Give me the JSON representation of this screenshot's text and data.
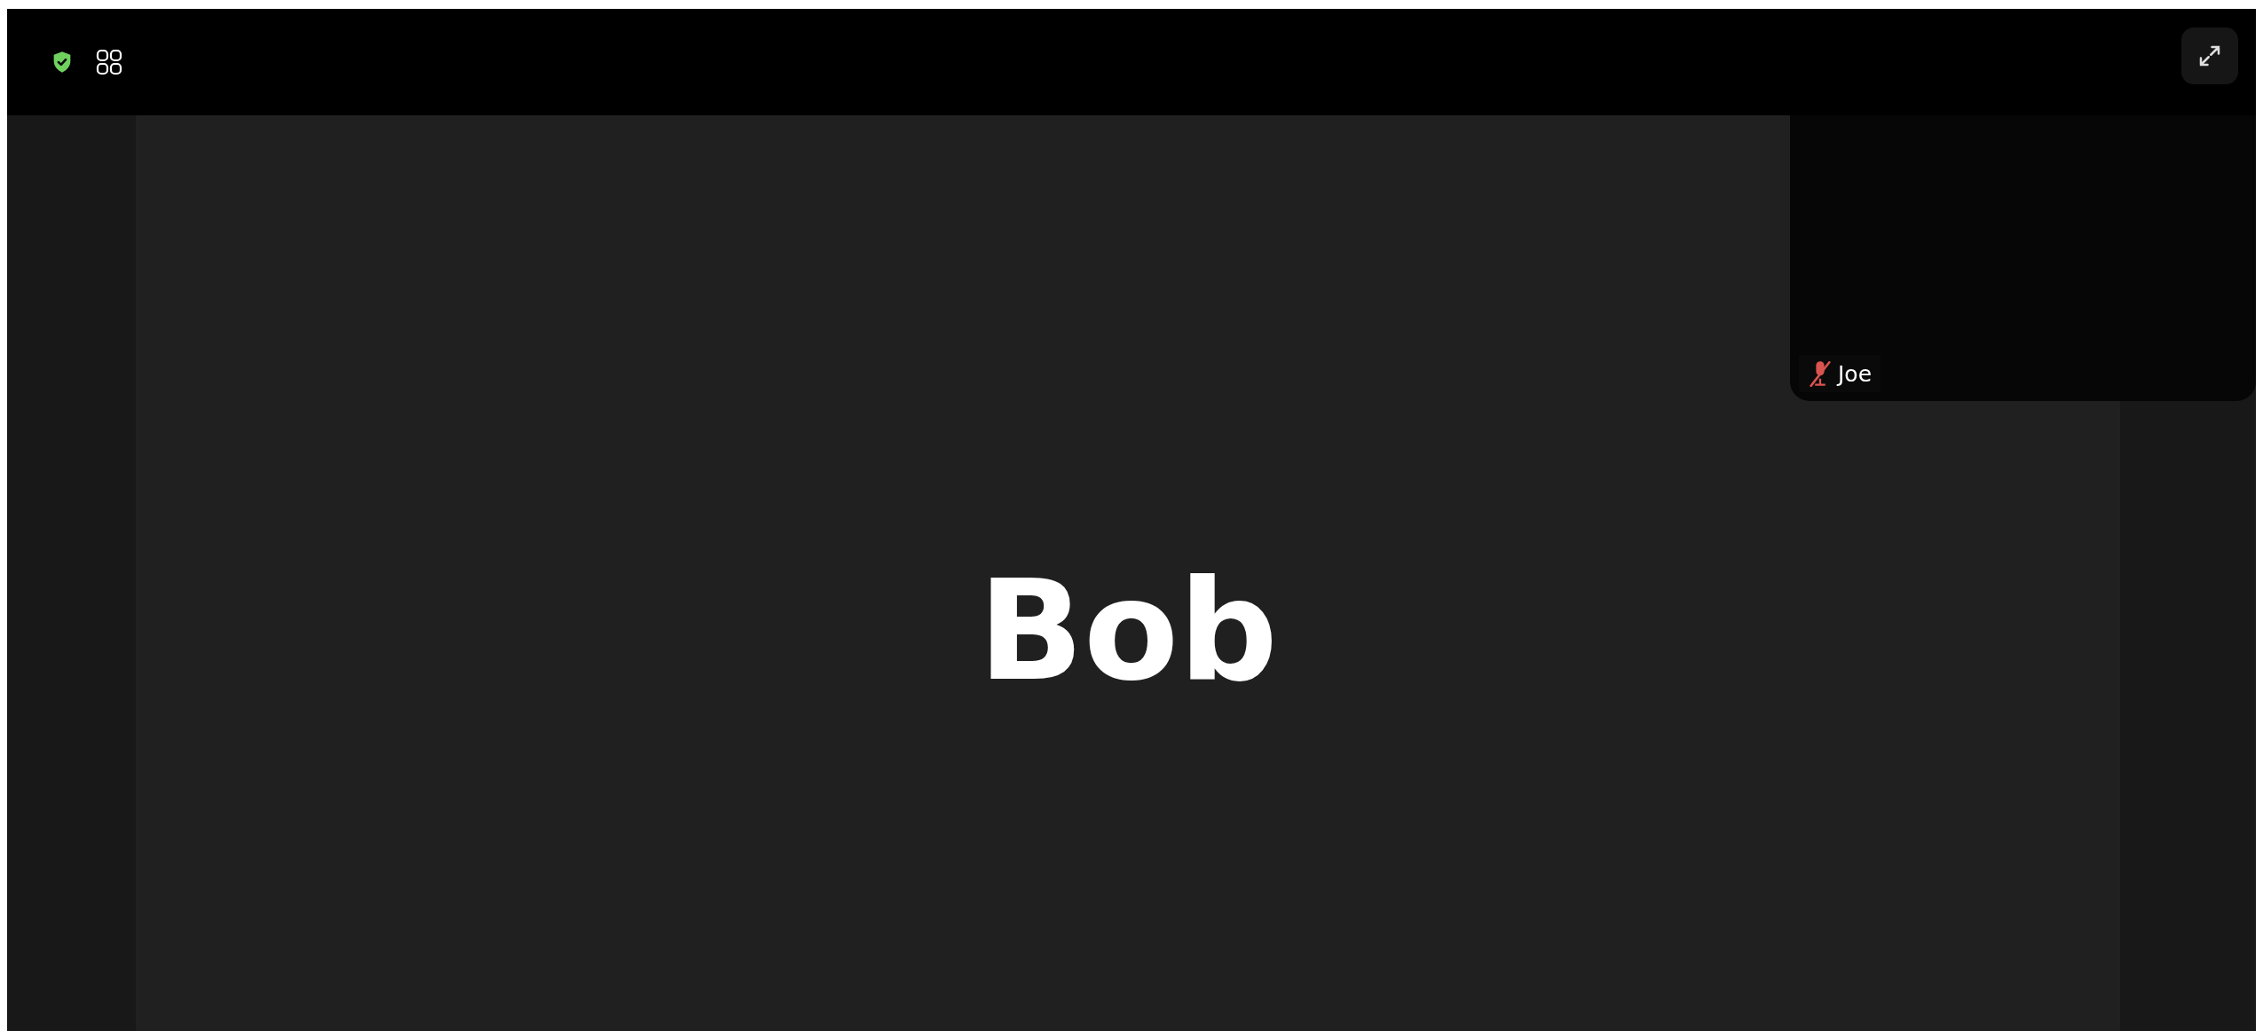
{
  "main_speaker": {
    "name": "Bob"
  },
  "self_view": {
    "name": "Joe",
    "muted": true
  }
}
